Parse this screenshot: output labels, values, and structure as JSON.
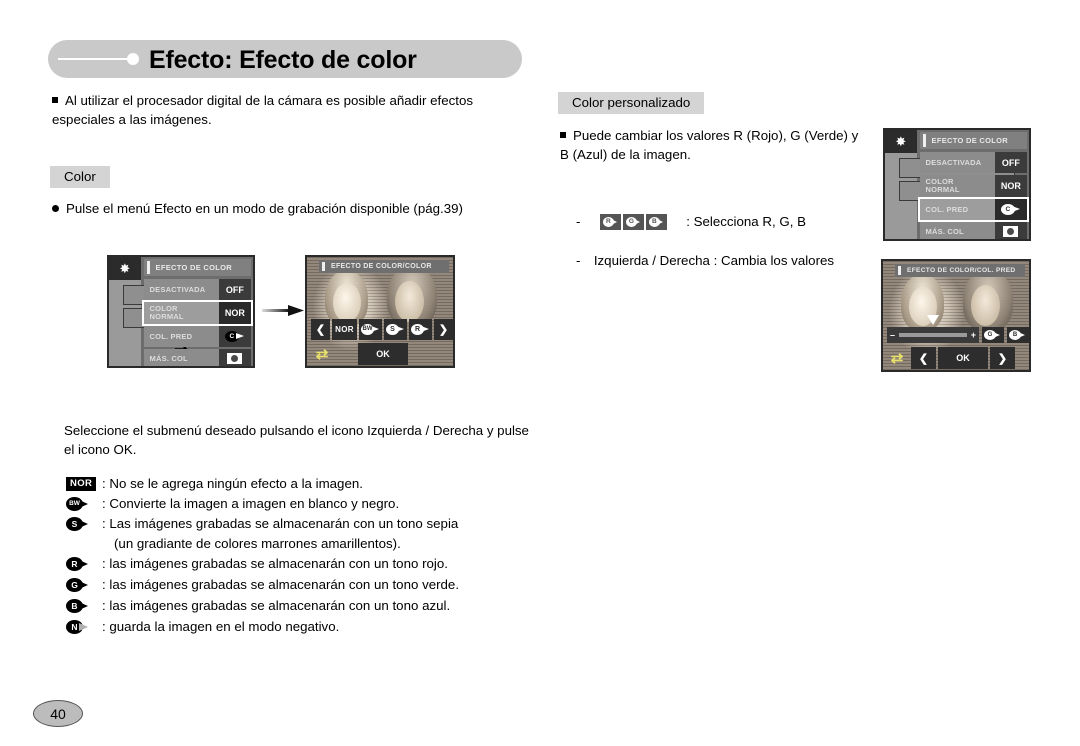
{
  "page": {
    "title": "Efecto: Efecto de color",
    "number": "40"
  },
  "intro": {
    "text": "Al utilizar el procesador digital de la cámara es posible añadir efectos especiales a las imágenes."
  },
  "left_column": {
    "section_label": "Color",
    "instruction": "Pulse el menú Efecto en un modo de grabación disponible (pág.39)",
    "flow_arrow_icon": "right-arrow-icon",
    "screen_menu": {
      "title": "EFECTO DE COLOR",
      "sidebar_icons": [
        "star-effect-icon",
        "filmstrip-icon",
        "camera-face-icon",
        "return-arrow-icon"
      ],
      "rows": [
        {
          "label": "DESACTIVADA",
          "value": "OFF",
          "selected": false
        },
        {
          "label": "COLOR\nNORMAL",
          "label_line1": "COLOR",
          "label_line2": "NORMAL",
          "value": "NOR",
          "selected": true
        },
        {
          "label": "COL. PRED",
          "value": "pill-c-icon",
          "selected": false
        },
        {
          "label": "MÁS. COL",
          "value": "square-dot-icon",
          "selected": false
        }
      ]
    },
    "screen_photo": {
      "title": "EFECTO DE COLOR/COLOR",
      "toolbar": [
        "prev-arrow-icon",
        "NOR",
        "BW",
        "S",
        "R",
        "next-arrow-icon"
      ],
      "back_icon": "return-arrow-icon",
      "ok_label": "OK"
    }
  },
  "right_column": {
    "section_label": "Color personalizado",
    "description": "Puede cambiar los valores R (Rojo), G (Verde) y  B (Azul) de la imagen.",
    "rgb_line": {
      "dash": "-",
      "chips": [
        "R",
        "G",
        "B"
      ],
      "text": ": Selecciona R, G, B"
    },
    "lr_line": {
      "dash": "-",
      "text": "Izquierda / Derecha : Cambia los valores"
    },
    "screen_menu": {
      "title": "EFECTO DE COLOR",
      "sidebar_icons": [
        "star-effect-icon",
        "filmstrip-icon",
        "camera-face-icon",
        "return-arrow-icon"
      ],
      "rows": [
        {
          "label": "DESACTIVADA",
          "value": "OFF",
          "selected": false
        },
        {
          "label_line1": "COLOR",
          "label_line2": "NORMAL",
          "value": "NOR",
          "selected": false
        },
        {
          "label": "COL. PRED",
          "value": "pill-c-icon",
          "selected": true
        },
        {
          "label": "MÁS. COL",
          "value": "square-dot-icon",
          "selected": false
        }
      ]
    },
    "screen_photo": {
      "title": "EFECTO DE COLOR/COL. PRED",
      "slider": {
        "minus": "–",
        "plus": "+",
        "position_percent": 36
      },
      "chips": [
        "G",
        "B"
      ],
      "back_icon": "return-arrow-icon",
      "prev_icon": "prev-arrow-icon",
      "ok_label": "OK",
      "next_icon": "next-arrow-icon"
    }
  },
  "bottom": {
    "paragraph": "Seleccione el submenú deseado pulsando el icono Izquierda / Derecha y pulse el icono OK.",
    "legend": [
      {
        "icon": "NOR",
        "icon_type": "nor-badge",
        "text": ": No se le agrega ningún efecto a la imagen."
      },
      {
        "icon": "BW",
        "icon_type": "pill",
        "text": ": Convierte la imagen a imagen en blanco y negro."
      },
      {
        "icon": "S",
        "icon_type": "pill",
        "text": ": Las imágenes grabadas se almacenarán con un tono sepia"
      },
      {
        "icon": "",
        "icon_type": "none",
        "text": "(un gradiante de colores marrones amarillentos)."
      },
      {
        "icon": "R",
        "icon_type": "pill",
        "text": ": las imágenes grabadas se almacenarán con un tono rojo."
      },
      {
        "icon": "G",
        "icon_type": "pill",
        "text": ": las imágenes grabadas se almacenarán con un tono verde."
      },
      {
        "icon": "B",
        "icon_type": "pill",
        "text": ": las imágenes grabadas se almacenarán con un tono azul."
      },
      {
        "icon": "N",
        "icon_type": "pill-grey",
        "text": ": guarda la imagen en el modo negativo."
      }
    ]
  },
  "colors": {
    "title_bar": "#c9c9c9",
    "chip_bg": "#d4d4d4",
    "page_badge": "#bcbcbc"
  }
}
